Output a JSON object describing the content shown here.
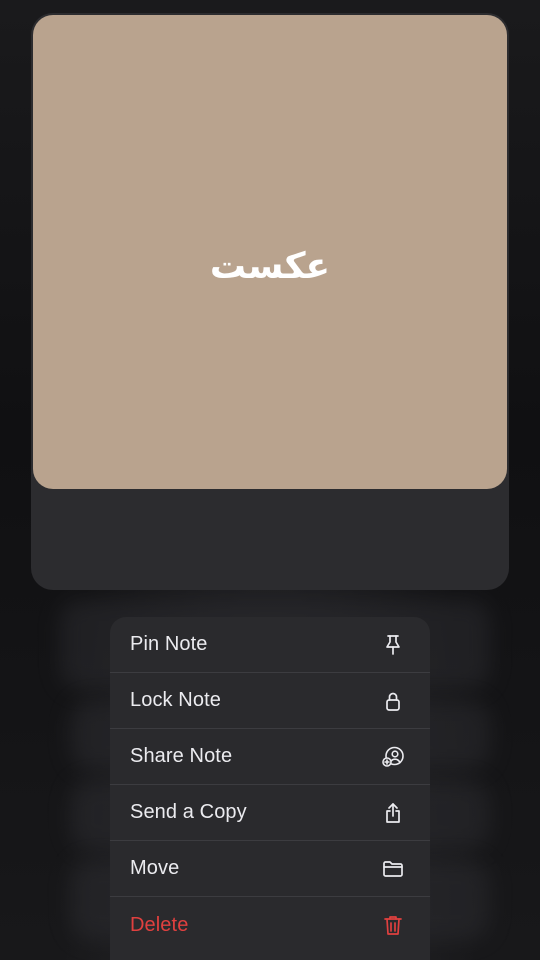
{
  "preview": {
    "text": "عكست",
    "image_color": "#b9a38e"
  },
  "menu": {
    "items": [
      {
        "label": "Pin Note",
        "icon": "pin-icon"
      },
      {
        "label": "Lock Note",
        "icon": "lock-icon"
      },
      {
        "label": "Share Note",
        "icon": "share-person-icon"
      },
      {
        "label": "Send a Copy",
        "icon": "share-upload-icon"
      },
      {
        "label": "Move",
        "icon": "folder-icon"
      },
      {
        "label": "Delete",
        "icon": "trash-icon",
        "destructive": true
      }
    ]
  },
  "colors": {
    "menu_background": "#2a2a2d",
    "text": "#ebebef",
    "destructive": "#e0403f"
  }
}
